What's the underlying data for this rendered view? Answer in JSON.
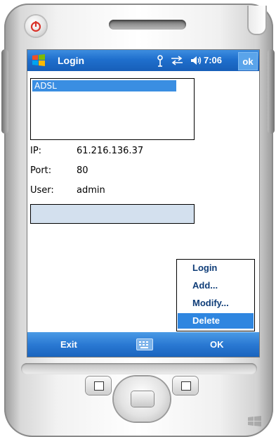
{
  "title_bar": {
    "title": "Login",
    "clock": "7:06",
    "ok_label": "ok",
    "status_icons": [
      "antenna-icon",
      "sync-arrows-icon",
      "speaker-icon"
    ]
  },
  "server_list": {
    "items": [
      {
        "label": "ADSL",
        "selected": true
      }
    ]
  },
  "info": {
    "ip_label": "IP:",
    "ip_value": "61.216.136.37",
    "port_label": "Port:",
    "port_value": "80",
    "user_label": "User:",
    "user_value": "admin"
  },
  "password_field": {
    "value": ""
  },
  "menu": {
    "items": [
      {
        "label": "Login",
        "selected": false
      },
      {
        "label": "Add...",
        "selected": false
      },
      {
        "label": "Modify...",
        "selected": false
      },
      {
        "label": "Delete",
        "selected": true
      }
    ]
  },
  "softkeys": {
    "left": "Exit",
    "right": "OK",
    "center_icon": "keyboard-icon"
  },
  "colors": {
    "titlebar": "#1f6fcd",
    "selection": "#3a8ee2",
    "field_bg": "#d3e0ee",
    "menu_text": "#0f3d78"
  }
}
